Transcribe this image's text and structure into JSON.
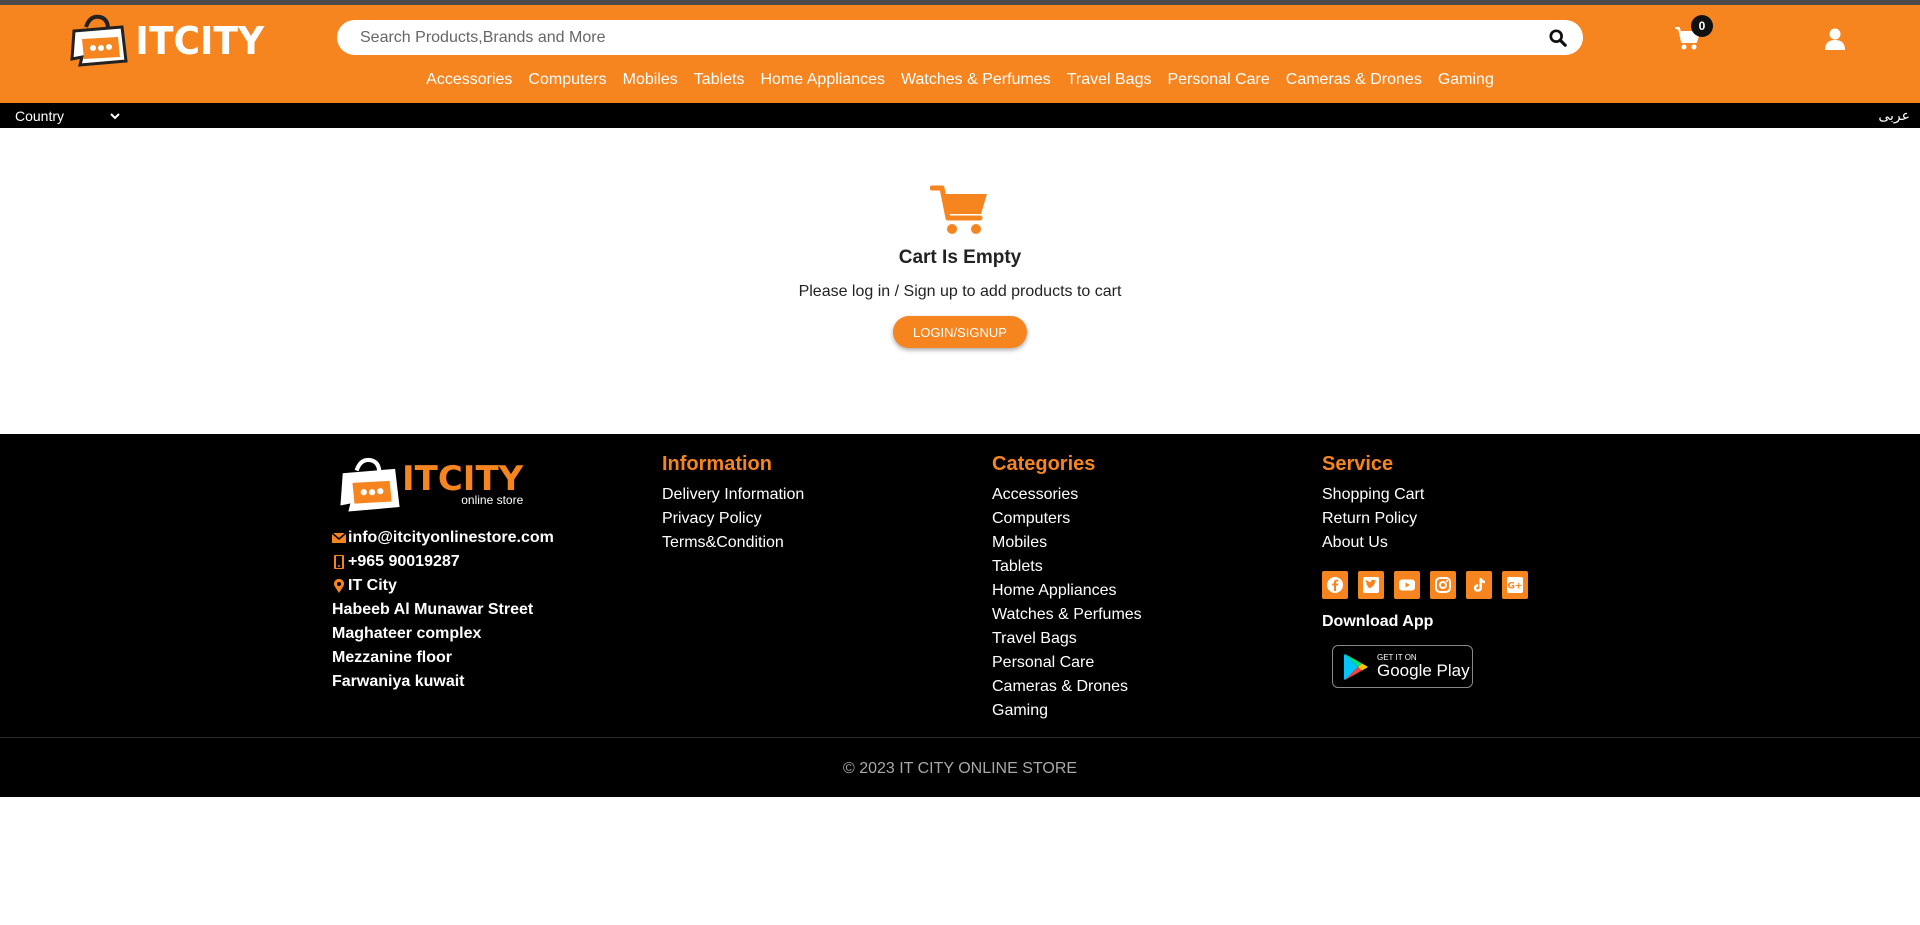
{
  "brand": {
    "name": "ITCITY",
    "accent": "#f6841f"
  },
  "search": {
    "placeholder": "Search Products,Brands and More"
  },
  "cart": {
    "count": "0"
  },
  "nav": [
    "Accessories",
    "Computers",
    "Mobiles",
    "Tablets",
    "Home Appliances",
    "Watches & Perfumes",
    "Travel Bags",
    "Personal Care",
    "Cameras & Drones",
    "Gaming"
  ],
  "subbar": {
    "country_label": "Country",
    "language_link": "عربى"
  },
  "empty_cart": {
    "title": "Cart Is Empty",
    "message": "Please log in / Sign up to add products to cart",
    "button": "LOGIN/SIGNUP"
  },
  "footer": {
    "logo": {
      "name": "ITCITY",
      "sub": "online store"
    },
    "contact": {
      "email": "info@itcityonlinestore.com",
      "phone": "+965 90019287",
      "location_name": "IT City",
      "address_lines": [
        "Habeeb Al Munawar Street",
        "Maghateer complex",
        "Mezzanine floor",
        "Farwaniya kuwait"
      ]
    },
    "information": {
      "title": "Information",
      "items": [
        "Delivery Information",
        "Privacy Policy",
        "Terms&Condition"
      ]
    },
    "categories": {
      "title": "Categories",
      "items": [
        "Accessories",
        "Computers",
        "Mobiles",
        "Tablets",
        "Home Appliances",
        "Watches & Perfumes",
        "Travel Bags",
        "Personal Care",
        "Cameras & Drones",
        "Gaming"
      ]
    },
    "service": {
      "title": "Service",
      "items": [
        "Shopping Cart",
        "Return Policy",
        "About Us"
      ]
    },
    "social_icons": [
      "facebook-icon",
      "twitter-icon",
      "youtube-icon",
      "instagram-icon",
      "tiktok-icon",
      "google-plus-icon"
    ],
    "download_app": "Download App",
    "google_play": {
      "small": "GET IT ON",
      "big": "Google Play"
    },
    "copyright": "© 2023 IT CITY ONLINE STORE"
  }
}
